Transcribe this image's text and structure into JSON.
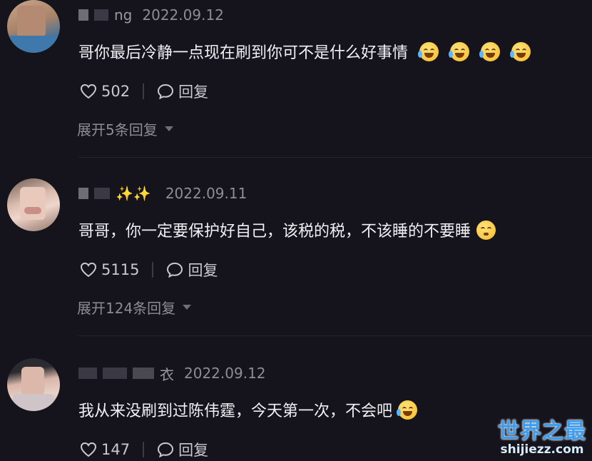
{
  "comments": [
    {
      "username": "ng",
      "date": "2022.09.12",
      "text": "哥你最后冷静一点现在刷到你可不是什么好事情",
      "likes": "502",
      "reply_label": "回复",
      "expand_label": "展开5条回复",
      "emojis": [
        "crying-laughing-emoji-icon",
        "crying-laughing-emoji-icon",
        "crying-laughing-emoji-icon",
        "crying-laughing-emoji-icon"
      ]
    },
    {
      "username": "✨✨",
      "date": "2022.09.11",
      "text": "哥哥，你一定要保护好自己，该税的税，不该睡的不要睡",
      "likes": "5115",
      "reply_label": "回复",
      "expand_label": "展开124条回复",
      "emojis": [
        "pleading-face-emoji-icon"
      ]
    },
    {
      "username": "衣",
      "date": "2022.09.12",
      "text": "我从来没刷到过陈伟霆，今天第一次，不会吧",
      "likes": "147",
      "reply_label": "回复",
      "emojis": [
        "loudly-crying-emoji-icon"
      ]
    }
  ],
  "watermark": {
    "title": "世界之最",
    "url": "shijiezz.com"
  }
}
